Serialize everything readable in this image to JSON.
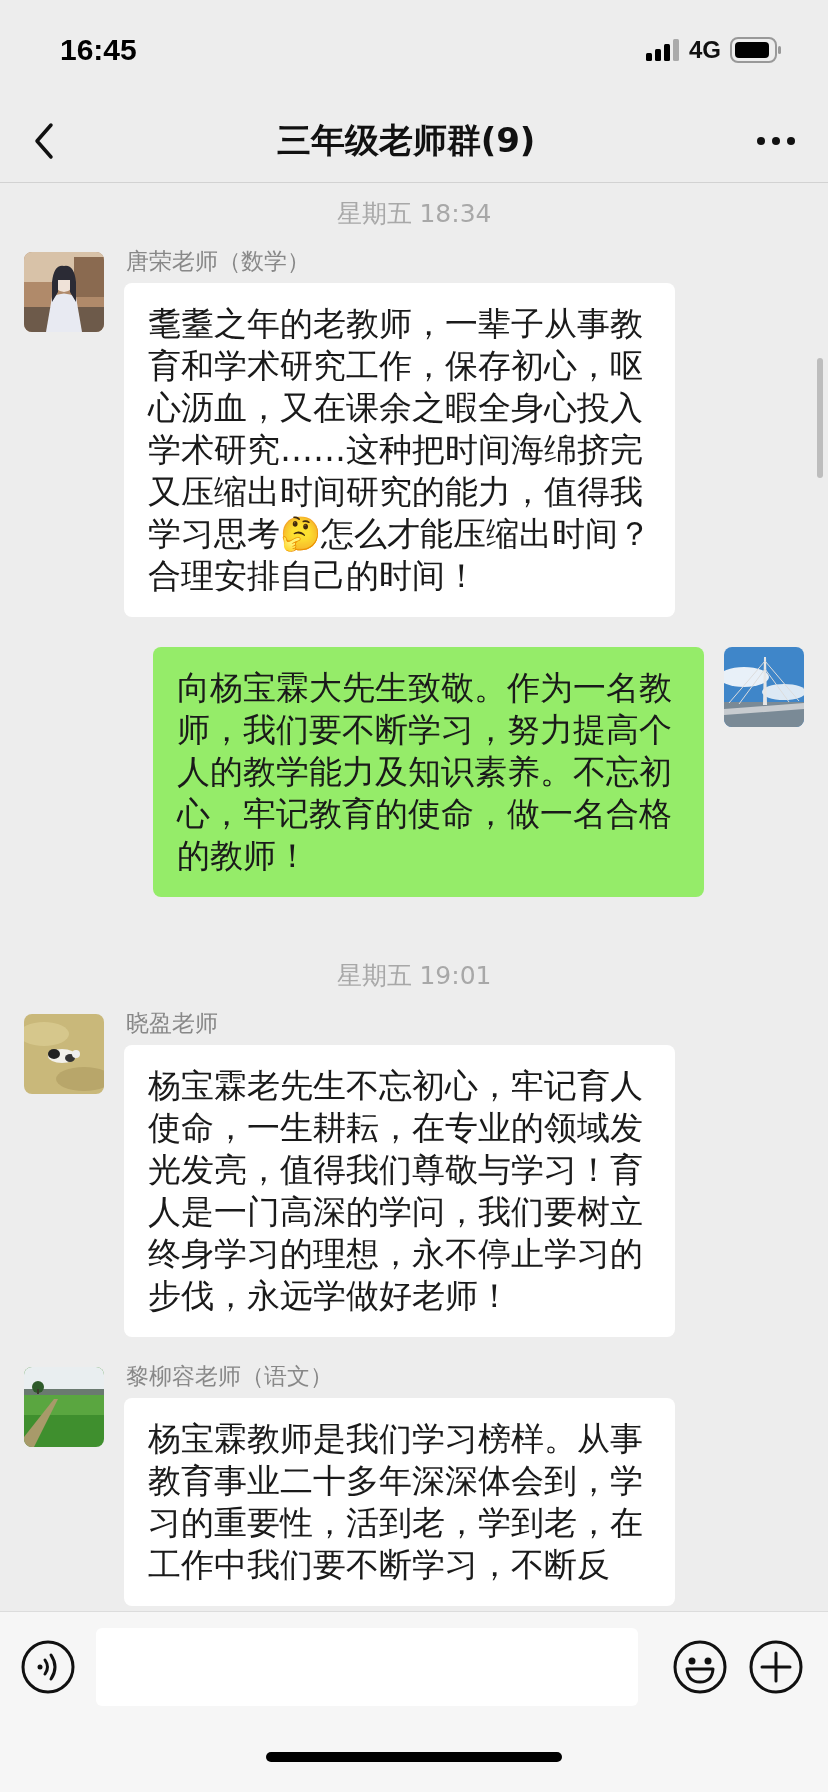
{
  "status_bar": {
    "time": "16:45",
    "network": "4G"
  },
  "header": {
    "title": "三年级老师群(9)"
  },
  "messages": [
    {
      "kind": "time",
      "text": "星期五 18:34"
    },
    {
      "kind": "incoming",
      "sender": "唐荣老师（数学）",
      "text": "耄耋之年的老教师，一辈子从事教育和学术研究工作，保存初心，呕心沥血，又在课余之暇全身心投入学术研究……这种把时间海绵挤完又压缩出时间研究的能力，值得我学习思考🤔怎么才能压缩出时间？合理安排自己的时间！"
    },
    {
      "kind": "outgoing",
      "text": "向杨宝霖大先生致敬。作为一名教师，我们要不断学习，努力提高个人的教学能力及知识素养。不忘初心，牢记教育的使命，做一名合格的教师！"
    },
    {
      "kind": "time",
      "text": "星期五 19:01"
    },
    {
      "kind": "incoming",
      "sender": "晓盈老师",
      "text": "杨宝霖老先生不忘初心，牢记育人使命，一生耕耘，在专业的领域发光发亮，值得我们尊敬与学习！育人是一门高深的学问，我们要树立终身学习的理想，永不停止学习的步伐，永远学做好老师！"
    },
    {
      "kind": "incoming",
      "sender": "黎柳容老师（语文）",
      "text": "杨宝霖教师是我们学习榜样。从事教育事业二十多年深深体会到，学习的重要性，活到老，学到老，在工作中我们要不断学习，不断反"
    }
  ]
}
